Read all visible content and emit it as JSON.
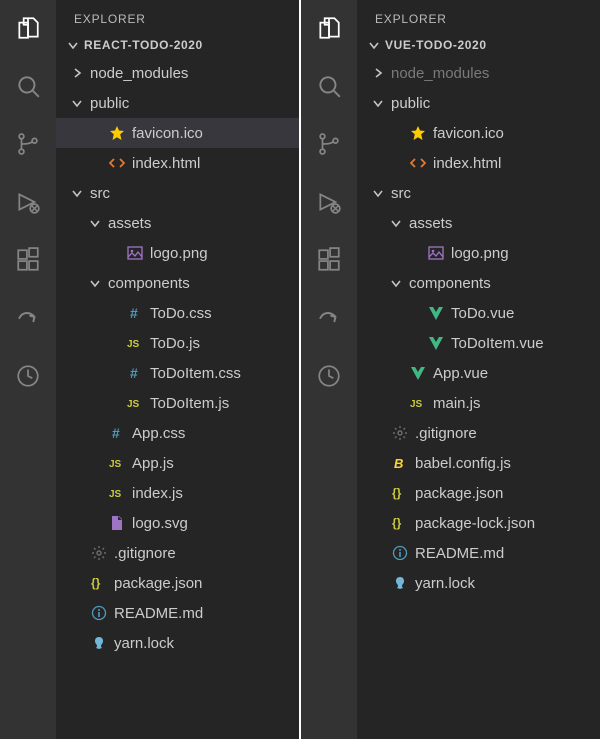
{
  "left": {
    "explorer_label": "EXPLORER",
    "project_name": "REACT-TODO-2020",
    "tree": [
      {
        "depth": 0,
        "kind": "folder",
        "open": false,
        "label": "node_modules",
        "icon": "chevron-right"
      },
      {
        "depth": 0,
        "kind": "folder",
        "open": true,
        "label": "public"
      },
      {
        "depth": 1,
        "kind": "file",
        "icon": "star",
        "color": "c-yellow",
        "label": "favicon.ico",
        "selected": true
      },
      {
        "depth": 1,
        "kind": "file",
        "icon": "code",
        "color": "c-orange",
        "label": "index.html"
      },
      {
        "depth": 0,
        "kind": "folder",
        "open": true,
        "label": "src"
      },
      {
        "depth": 1,
        "kind": "folder",
        "open": true,
        "label": "assets"
      },
      {
        "depth": 2,
        "kind": "file",
        "icon": "image",
        "color": "c-purple",
        "label": "logo.png"
      },
      {
        "depth": 1,
        "kind": "folder",
        "open": true,
        "label": "components"
      },
      {
        "depth": 2,
        "kind": "file",
        "icon": "hash",
        "color": "c-blue",
        "label": "ToDo.css"
      },
      {
        "depth": 2,
        "kind": "file",
        "icon": "js",
        "color": "c-jsyel",
        "label": "ToDo.js"
      },
      {
        "depth": 2,
        "kind": "file",
        "icon": "hash",
        "color": "c-blue",
        "label": "ToDoItem.css"
      },
      {
        "depth": 2,
        "kind": "file",
        "icon": "js",
        "color": "c-jsyel",
        "label": "ToDoItem.js"
      },
      {
        "depth": 1,
        "kind": "file",
        "icon": "hash",
        "color": "c-blue",
        "label": "App.css"
      },
      {
        "depth": 1,
        "kind": "file",
        "icon": "js",
        "color": "c-jsyel",
        "label": "App.js"
      },
      {
        "depth": 1,
        "kind": "file",
        "icon": "js",
        "color": "c-jsyel",
        "label": "index.js"
      },
      {
        "depth": 1,
        "kind": "file",
        "icon": "svgfile",
        "color": "c-purple",
        "label": "logo.svg"
      },
      {
        "depth": 0,
        "kind": "file",
        "icon": "gear",
        "color": "c-gray",
        "label": ".gitignore"
      },
      {
        "depth": 0,
        "kind": "file",
        "icon": "json",
        "color": "c-jsyel",
        "label": "package.json"
      },
      {
        "depth": 0,
        "kind": "file",
        "icon": "info",
        "color": "c-info",
        "label": "README.md"
      },
      {
        "depth": 0,
        "kind": "file",
        "icon": "yarn",
        "color": "c-lblue",
        "label": "yarn.lock"
      }
    ]
  },
  "right": {
    "explorer_label": "EXPLORER",
    "project_name": "VUE-TODO-2020",
    "tree": [
      {
        "depth": 0,
        "kind": "folder",
        "open": false,
        "label": "node_modules",
        "dim": true
      },
      {
        "depth": 0,
        "kind": "folder",
        "open": true,
        "label": "public"
      },
      {
        "depth": 1,
        "kind": "file",
        "icon": "star",
        "color": "c-yellow",
        "label": "favicon.ico"
      },
      {
        "depth": 1,
        "kind": "file",
        "icon": "code",
        "color": "c-orange",
        "label": "index.html"
      },
      {
        "depth": 0,
        "kind": "folder",
        "open": true,
        "label": "src"
      },
      {
        "depth": 1,
        "kind": "folder",
        "open": true,
        "label": "assets"
      },
      {
        "depth": 2,
        "kind": "file",
        "icon": "image",
        "color": "c-purple",
        "label": "logo.png"
      },
      {
        "depth": 1,
        "kind": "folder",
        "open": true,
        "label": "components"
      },
      {
        "depth": 2,
        "kind": "file",
        "icon": "vue",
        "color": "c-green",
        "label": "ToDo.vue"
      },
      {
        "depth": 2,
        "kind": "file",
        "icon": "vue",
        "color": "c-green",
        "label": "ToDoItem.vue"
      },
      {
        "depth": 1,
        "kind": "file",
        "icon": "vue",
        "color": "c-green",
        "label": "App.vue"
      },
      {
        "depth": 1,
        "kind": "file",
        "icon": "js",
        "color": "c-jsyel",
        "label": "main.js"
      },
      {
        "depth": 0,
        "kind": "file",
        "icon": "gear",
        "color": "c-gray",
        "label": ".gitignore"
      },
      {
        "depth": 0,
        "kind": "file",
        "icon": "babel",
        "color": "c-babel",
        "label": "babel.config.js"
      },
      {
        "depth": 0,
        "kind": "file",
        "icon": "json",
        "color": "c-jsyel",
        "label": "package.json"
      },
      {
        "depth": 0,
        "kind": "file",
        "icon": "json",
        "color": "c-jsyel",
        "label": "package-lock.json"
      },
      {
        "depth": 0,
        "kind": "file",
        "icon": "info",
        "color": "c-info",
        "label": "README.md"
      },
      {
        "depth": 0,
        "kind": "file",
        "icon": "yarn",
        "color": "c-lblue",
        "label": "yarn.lock"
      }
    ]
  },
  "activity_icons": [
    "files",
    "search",
    "git",
    "debug",
    "extensions",
    "share",
    "accounts"
  ]
}
